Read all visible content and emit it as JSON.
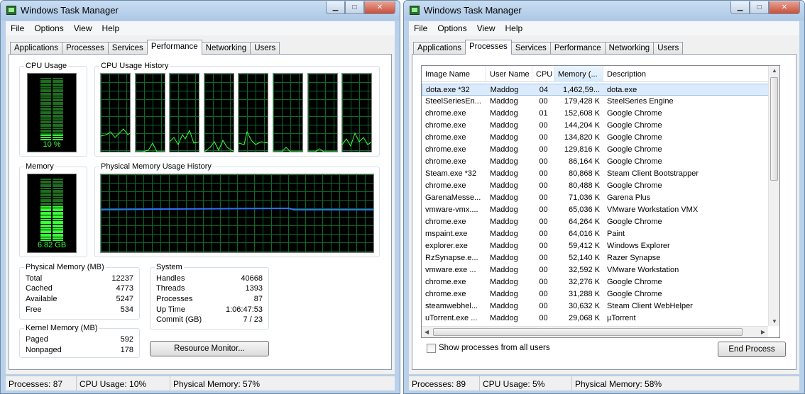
{
  "left": {
    "title": "Windows Task Manager",
    "menu": [
      "File",
      "Options",
      "View",
      "Help"
    ],
    "tabs": [
      "Applications",
      "Processes",
      "Services",
      "Performance",
      "Networking",
      "Users"
    ],
    "active_tab": "Performance",
    "cpu_usage": {
      "label": "CPU Usage",
      "value_text": "10 %",
      "level": 0.1
    },
    "cpu_history_label": "CPU Usage History",
    "memory": {
      "label": "Memory",
      "value_text": "6.82 GB",
      "level": 0.57
    },
    "mem_history_label": "Physical Memory Usage History",
    "physical_memory": {
      "label": "Physical Memory (MB)",
      "rows": [
        {
          "k": "Total",
          "v": "12237"
        },
        {
          "k": "Cached",
          "v": "4773"
        },
        {
          "k": "Available",
          "v": "5247"
        },
        {
          "k": "Free",
          "v": "534"
        }
      ]
    },
    "kernel_memory": {
      "label": "Kernel Memory (MB)",
      "rows": [
        {
          "k": "Paged",
          "v": "592"
        },
        {
          "k": "Nonpaged",
          "v": "178"
        }
      ]
    },
    "system": {
      "label": "System",
      "rows": [
        {
          "k": "Handles",
          "v": "40668"
        },
        {
          "k": "Threads",
          "v": "1393"
        },
        {
          "k": "Processes",
          "v": "87"
        },
        {
          "k": "Up Time",
          "v": "1:06:47:53"
        },
        {
          "k": "Commit (GB)",
          "v": "7 / 23"
        }
      ]
    },
    "resource_monitor_button": "Resource Monitor...",
    "status": {
      "processes": "Processes: 87",
      "cpu": "CPU Usage: 10%",
      "memory": "Physical Memory: 57%"
    }
  },
  "right": {
    "title": "Windows Task Manager",
    "menu": [
      "File",
      "Options",
      "View",
      "Help"
    ],
    "tabs": [
      "Applications",
      "Processes",
      "Services",
      "Performance",
      "Networking",
      "Users"
    ],
    "active_tab": "Processes",
    "columns": [
      "Image Name",
      "User Name",
      "CPU",
      "Memory (...",
      "Description"
    ],
    "processes": [
      {
        "name": "dota.exe *32",
        "user": "Maddog",
        "cpu": "04",
        "mem": "1,462,59...",
        "desc": "dota.exe"
      },
      {
        "name": "SteelSeriesEn...",
        "user": "Maddog",
        "cpu": "00",
        "mem": "179,428 K",
        "desc": "SteelSeries Engine"
      },
      {
        "name": "chrome.exe",
        "user": "Maddog",
        "cpu": "01",
        "mem": "152,608 K",
        "desc": "Google Chrome"
      },
      {
        "name": "chrome.exe",
        "user": "Maddog",
        "cpu": "00",
        "mem": "144,204 K",
        "desc": "Google Chrome"
      },
      {
        "name": "chrome.exe",
        "user": "Maddog",
        "cpu": "00",
        "mem": "134,820 K",
        "desc": "Google Chrome"
      },
      {
        "name": "chrome.exe",
        "user": "Maddog",
        "cpu": "00",
        "mem": "129,816 K",
        "desc": "Google Chrome"
      },
      {
        "name": "chrome.exe",
        "user": "Maddog",
        "cpu": "00",
        "mem": "86,164 K",
        "desc": "Google Chrome"
      },
      {
        "name": "Steam.exe *32",
        "user": "Maddog",
        "cpu": "00",
        "mem": "80,868 K",
        "desc": "Steam Client Bootstrapper"
      },
      {
        "name": "chrome.exe",
        "user": "Maddog",
        "cpu": "00",
        "mem": "80,488 K",
        "desc": "Google Chrome"
      },
      {
        "name": "GarenaMesse...",
        "user": "Maddog",
        "cpu": "00",
        "mem": "71,036 K",
        "desc": "Garena Plus"
      },
      {
        "name": "vmware-vmx....",
        "user": "Maddog",
        "cpu": "00",
        "mem": "65,036 K",
        "desc": "VMware Workstation VMX"
      },
      {
        "name": "chrome.exe",
        "user": "Maddog",
        "cpu": "00",
        "mem": "64,264 K",
        "desc": "Google Chrome"
      },
      {
        "name": "mspaint.exe",
        "user": "Maddog",
        "cpu": "00",
        "mem": "64,016 K",
        "desc": "Paint"
      },
      {
        "name": "explorer.exe",
        "user": "Maddog",
        "cpu": "00",
        "mem": "59,412 K",
        "desc": "Windows Explorer"
      },
      {
        "name": "RzSynapse.e...",
        "user": "Maddog",
        "cpu": "00",
        "mem": "52,140 K",
        "desc": "Razer Synapse"
      },
      {
        "name": "vmware.exe ...",
        "user": "Maddog",
        "cpu": "00",
        "mem": "32,592 K",
        "desc": "VMware Workstation"
      },
      {
        "name": "chrome.exe",
        "user": "Maddog",
        "cpu": "00",
        "mem": "32,276 K",
        "desc": "Google Chrome"
      },
      {
        "name": "chrome.exe",
        "user": "Maddog",
        "cpu": "00",
        "mem": "31,288 K",
        "desc": "Google Chrome"
      },
      {
        "name": "steamwebhel...",
        "user": "Maddog",
        "cpu": "00",
        "mem": "30,632 K",
        "desc": "Steam Client WebHelper"
      },
      {
        "name": "uTorrent.exe ...",
        "user": "Maddog",
        "cpu": "00",
        "mem": "29,068 K",
        "desc": "µTorrent"
      }
    ],
    "show_all_label": "Show processes from all users",
    "end_process_button": "End Process",
    "status": {
      "processes": "Processes: 89",
      "cpu": "CPU Usage: 5%",
      "memory": "Physical Memory: 58%"
    }
  }
}
